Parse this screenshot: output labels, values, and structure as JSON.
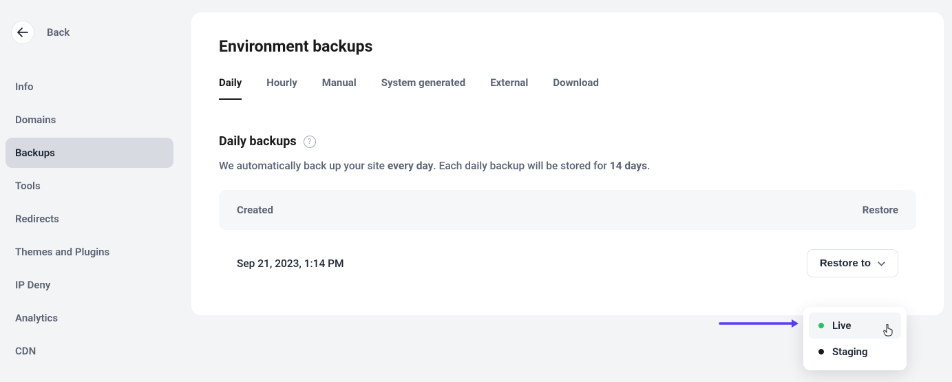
{
  "sidebar": {
    "back_label": "Back",
    "items": [
      {
        "label": "Info",
        "active": false
      },
      {
        "label": "Domains",
        "active": false
      },
      {
        "label": "Backups",
        "active": true
      },
      {
        "label": "Tools",
        "active": false
      },
      {
        "label": "Redirects",
        "active": false
      },
      {
        "label": "Themes and Plugins",
        "active": false
      },
      {
        "label": "IP Deny",
        "active": false
      },
      {
        "label": "Analytics",
        "active": false
      },
      {
        "label": "CDN",
        "active": false
      }
    ]
  },
  "page": {
    "title": "Environment backups",
    "tabs": [
      {
        "label": "Daily",
        "active": true
      },
      {
        "label": "Hourly",
        "active": false
      },
      {
        "label": "Manual",
        "active": false
      },
      {
        "label": "System generated",
        "active": false
      },
      {
        "label": "External",
        "active": false
      },
      {
        "label": "Download",
        "active": false
      }
    ],
    "section_title": "Daily backups",
    "description_pre": "We automatically back up your site ",
    "description_bold1": "every day",
    "description_mid": ". Each daily backup will be stored for ",
    "description_bold2": "14 days",
    "description_post": ".",
    "table": {
      "headers": {
        "created": "Created",
        "restore": "Restore"
      },
      "rows": [
        {
          "created": "Sep 21, 2023, 1:14 PM",
          "restore_label": "Restore to"
        }
      ]
    },
    "dropdown": {
      "options": [
        {
          "label": "Live",
          "color": "green",
          "hover": true
        },
        {
          "label": "Staging",
          "color": "black",
          "hover": false
        }
      ]
    }
  }
}
